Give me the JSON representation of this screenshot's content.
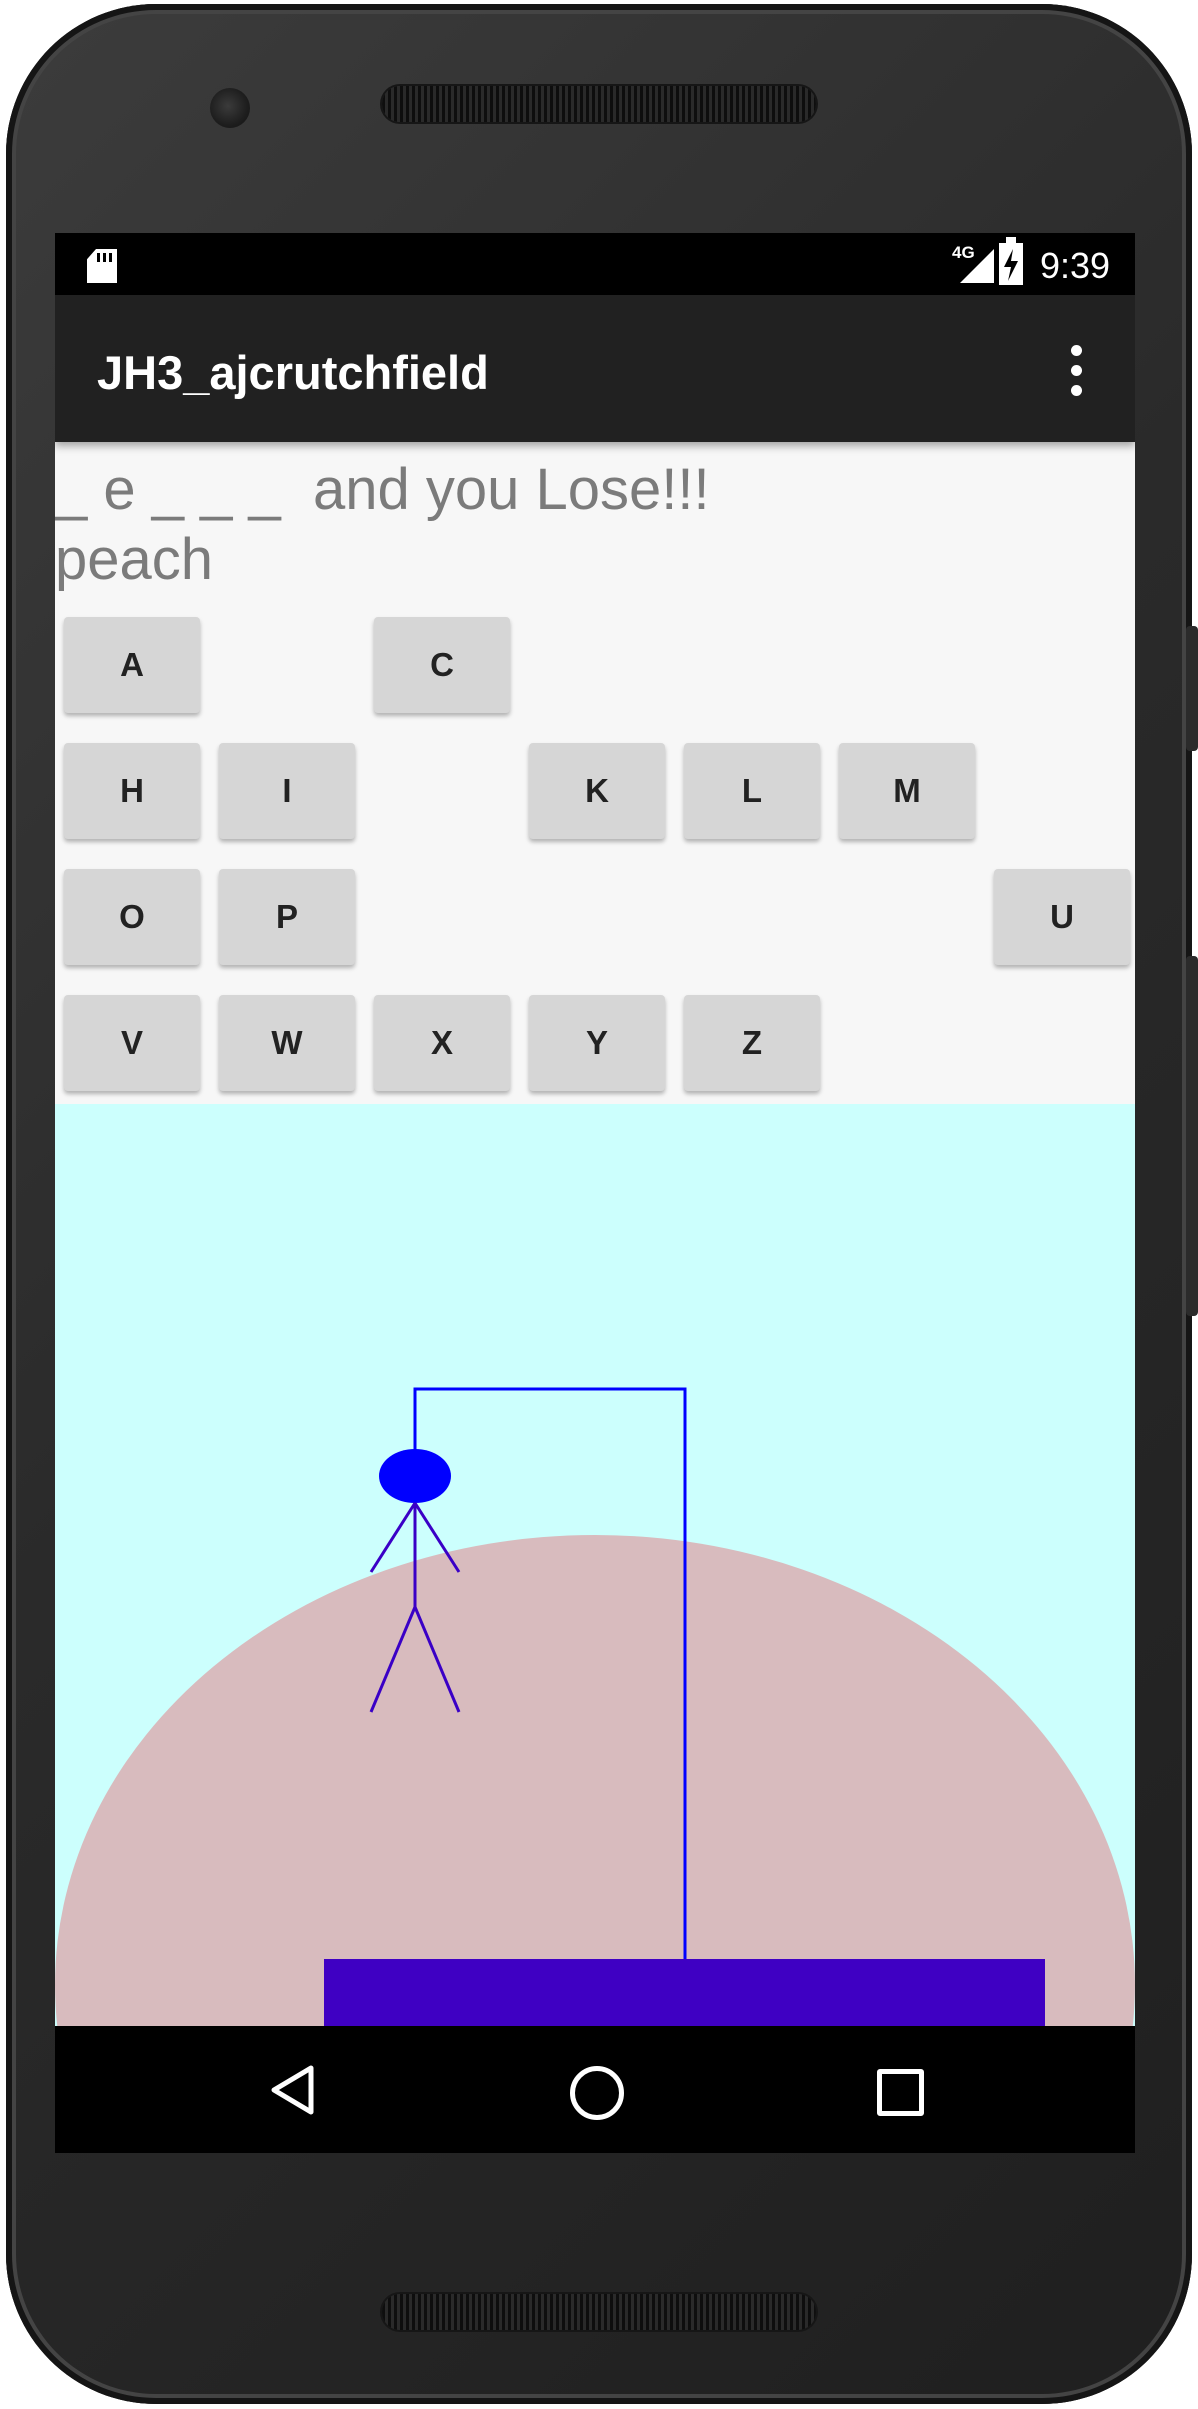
{
  "status_bar": {
    "network": "4G",
    "time": "9:39"
  },
  "app_bar": {
    "title": "JH3_ajcrutchfield",
    "overflow_icon": "more-vert-icon"
  },
  "game": {
    "status_line": "_ e _ _ _  and you Lose!!!",
    "answer": "peach",
    "remaining_letters": [
      "A",
      "C",
      "H",
      "I",
      "K",
      "L",
      "M",
      "O",
      "P",
      "U",
      "V",
      "W",
      "X",
      "Y",
      "Z"
    ]
  },
  "keyboard": {
    "row1": [
      "A",
      "C"
    ],
    "row2": [
      "H",
      "I",
      "K",
      "L",
      "M"
    ],
    "row3": [
      "O",
      "P",
      "U"
    ],
    "row4": [
      "V",
      "W",
      "X",
      "Y",
      "Z"
    ]
  },
  "drawing": {
    "sky_color": "#ccfffd",
    "hill_color": "#d8bbbe",
    "gallows_color": "#0000ff",
    "platform_color": "#3f00c3",
    "head_color": "#0000ff"
  },
  "nav_bar": {
    "back_icon": "back-triangle-icon",
    "home_icon": "home-circle-icon",
    "recents_icon": "recents-square-icon"
  }
}
